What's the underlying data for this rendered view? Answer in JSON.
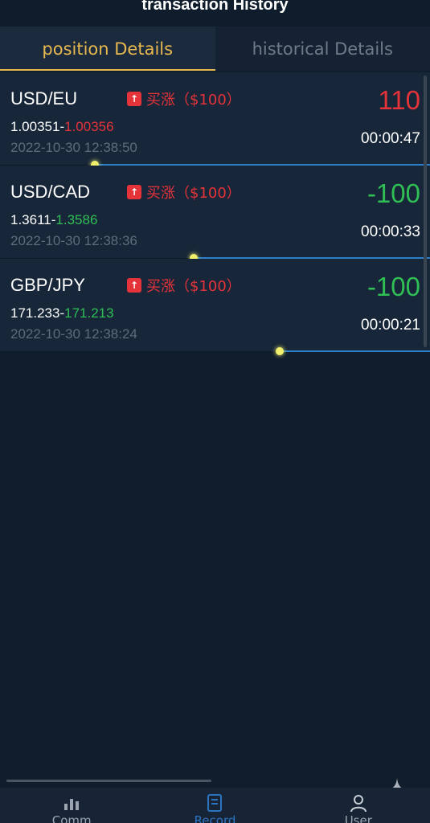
{
  "header": {
    "title": "transaction History"
  },
  "tabs": [
    {
      "label": "position Details",
      "active": true
    },
    {
      "label": "historical Details",
      "active": false
    }
  ],
  "positions": [
    {
      "pair": "USD/EU",
      "direction": "买涨（$100）",
      "open_price": "1.00351",
      "close_price": "1.00356",
      "close_color": "red",
      "timestamp": "2022-10-30 12:38:50",
      "pnl": "110",
      "pnl_color": "red",
      "timer": "00:00:47",
      "progress": 0.78
    },
    {
      "pair": "USD/CAD",
      "direction": "买涨（$100）",
      "open_price": "1.3611",
      "close_price": "1.3586",
      "close_color": "green",
      "timestamp": "2022-10-30 12:38:36",
      "pnl": "-100",
      "pnl_color": "green",
      "timer": "00:00:33",
      "progress": 0.55
    },
    {
      "pair": "GBP/JPY",
      "direction": "买涨（$100）",
      "open_price": "171.233",
      "close_price": "171.213",
      "close_color": "green",
      "timestamp": "2022-10-30 12:38:24",
      "pnl": "-100",
      "pnl_color": "green",
      "timer": "00:00:21",
      "progress": 0.35
    }
  ],
  "nav": [
    {
      "label": "Comm",
      "icon": "chart-icon",
      "active": false
    },
    {
      "label": "Record",
      "icon": "document-icon",
      "active": true
    },
    {
      "label": "User",
      "icon": "user-icon",
      "active": false
    }
  ],
  "colors": {
    "accent": "#e6b84f",
    "up": "#e5333a",
    "down": "#2fbf55",
    "nav_active": "#2c74c2"
  }
}
